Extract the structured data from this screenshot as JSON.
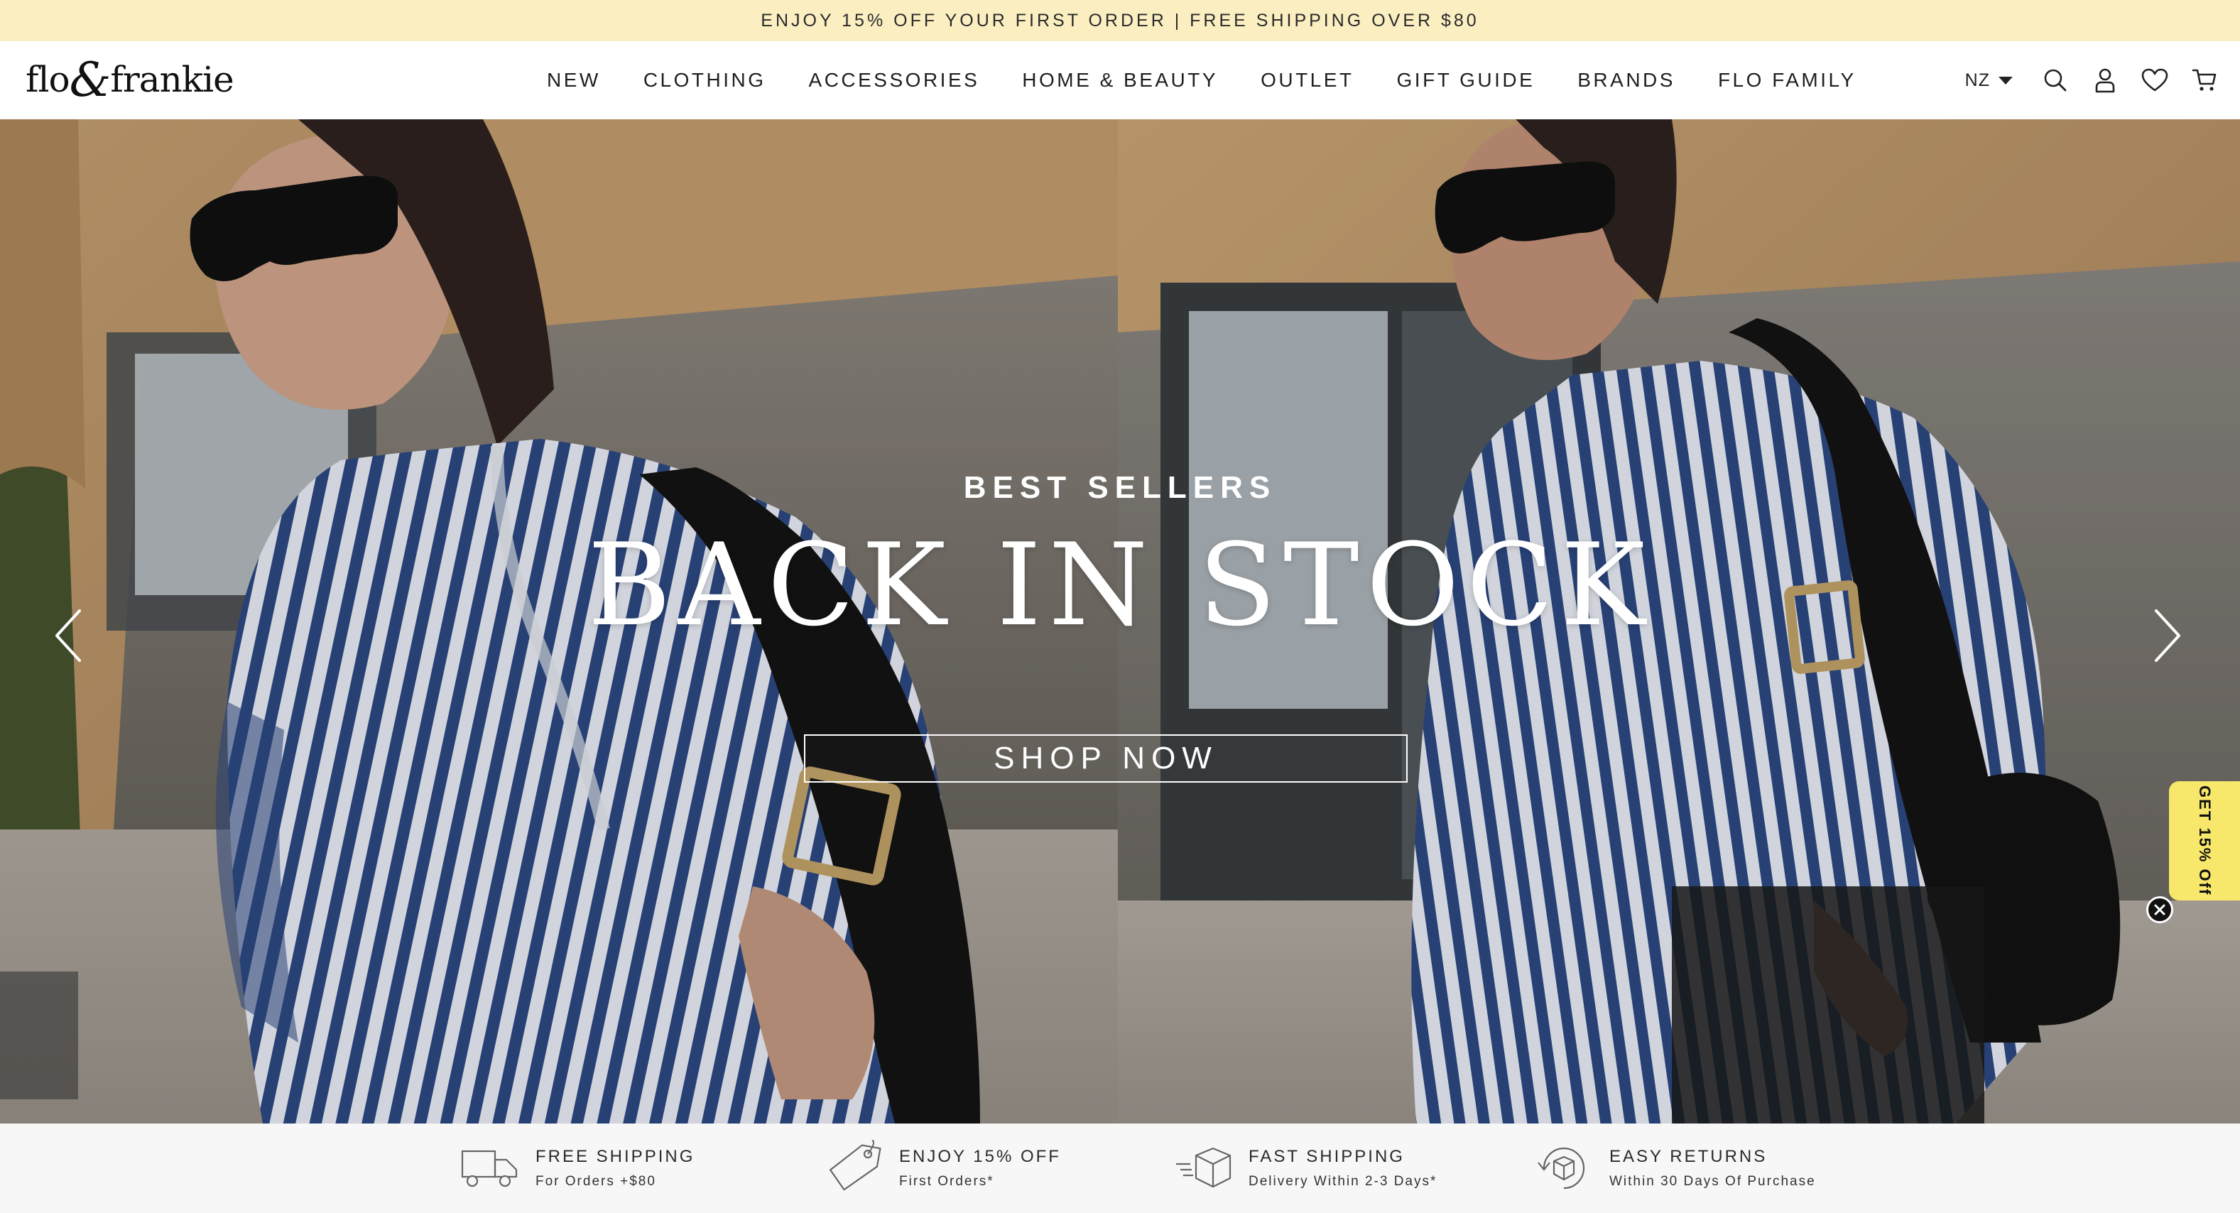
{
  "announcement": {
    "text": "ENJOY 15% OFF YOUR FIRST ORDER | FREE SHIPPING OVER $80"
  },
  "header": {
    "logo": {
      "part1": "flo",
      "amp": "&",
      "part2": "frankie"
    },
    "nav": [
      "NEW",
      "CLOTHING",
      "ACCESSORIES",
      "HOME & BEAUTY",
      "OUTLET",
      "GIFT GUIDE",
      "BRANDS",
      "FLO FAMILY"
    ],
    "region": "NZ",
    "icons": [
      "search-icon",
      "account-icon",
      "wishlist-heart-icon",
      "cart-icon"
    ]
  },
  "hero": {
    "eyebrow": "BEST SELLERS",
    "title": "BACK IN STOCK",
    "cta": "SHOP NOW",
    "prev_icon": "chevron-left-icon",
    "next_icon": "chevron-right-icon"
  },
  "promo_tab": {
    "label": "GET 15% Off",
    "close_icon": "close-icon"
  },
  "benefits": [
    {
      "icon": "delivery-truck-icon",
      "title": "FREE SHIPPING",
      "subtitle": "For Orders +$80"
    },
    {
      "icon": "price-tag-icon",
      "title": "ENJOY 15% OFF",
      "subtitle": "First Orders*"
    },
    {
      "icon": "fast-box-icon",
      "title": "FAST SHIPPING",
      "subtitle": "Delivery Within 2-3 Days*"
    },
    {
      "icon": "returns-box-icon",
      "title": "EASY RETURNS",
      "subtitle": "Within 30 Days Of Purchase"
    }
  ],
  "colors": {
    "announcement_bg": "#fbefc2",
    "promo_tab_bg": "#f7e76a",
    "benefits_bg": "#f7f7f7",
    "shirt_stripe_navy": "#2e4a86"
  }
}
